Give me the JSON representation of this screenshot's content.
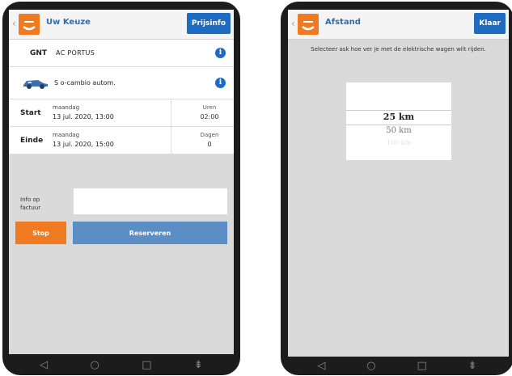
{
  "left_screen": {
    "topbar": {
      "back": "‹",
      "title": "Uw Keuze",
      "button": "Prijsinfo"
    },
    "gnt": {
      "label": "GNT",
      "value": "AC PORTUS"
    },
    "car": {
      "text": "S o-cambio autom."
    },
    "start": {
      "label": "Start",
      "day": "maandag",
      "date": "13 jul. 2020, 13:00",
      "side_label": "Uren",
      "side_value": "02:00"
    },
    "end": {
      "label": "Einde",
      "day": "maandag",
      "date": "13 jul. 2020, 15:00",
      "side_label": "Dagen",
      "side_value": "0"
    },
    "info_label": "Info op factuur",
    "info_value": "",
    "cancel_button": "Stop",
    "reserve_button": "Reserveren"
  },
  "right_screen": {
    "topbar": {
      "back": "‹",
      "title": "Afstand",
      "button": "Klaar"
    },
    "instruction": "Selecteer ask hoe ver je met de elektrische wagen wilt rijden.",
    "picker": {
      "selected": "25 km",
      "next": "50 km",
      "faded": "100 km"
    }
  },
  "navbar": {
    "back": "◁",
    "home": "○",
    "recent": "□",
    "menu": "⇟"
  },
  "colors": {
    "brand_orange": "#f07a22",
    "brand_blue": "#1f6bc1",
    "reserve_blue": "#5b8ec4"
  }
}
